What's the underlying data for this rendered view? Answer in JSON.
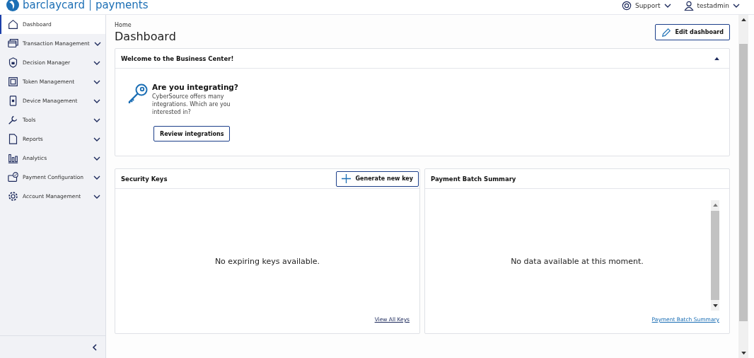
{
  "header": {
    "brand": "barclaycard",
    "product": "payments",
    "support": "Support",
    "user": "testadmin"
  },
  "sidebar": {
    "items": [
      {
        "label": "Dashboard",
        "selected": true
      },
      {
        "label": "Transaction Management",
        "selected": false,
        "expanded": false
      },
      {
        "label": "Decision Manager",
        "selected": false,
        "expanded": false
      },
      {
        "label": "Token Management",
        "selected": false,
        "expanded": false
      },
      {
        "label": "Device Management",
        "selected": false,
        "expanded": false
      },
      {
        "label": "Tools",
        "selected": false,
        "expanded": false
      },
      {
        "label": "Reports",
        "selected": false,
        "expanded": false
      },
      {
        "label": "Analytics",
        "selected": false,
        "expanded": false
      },
      {
        "label": "Payment Configuration",
        "selected": false,
        "expanded": false
      },
      {
        "label": "Account Management",
        "selected": false,
        "expanded": false
      }
    ]
  },
  "breadcrumb": "Home",
  "page_title": "Dashboard",
  "edit_button": "Edit dashboard",
  "welcome": {
    "title": "Welcome to the Business Center!",
    "expanded": true,
    "heading": "Are you integrating?",
    "text": "CyberSource offers many integrations. Which are you interested in?",
    "button": "Review integrations"
  },
  "security_keys": {
    "title": "Security Keys",
    "button": "Generate new key",
    "empty": "No expiring keys available.",
    "link": "View All Keys"
  },
  "batch_summary": {
    "title": "Payment Batch Summary",
    "empty": "No data available at this moment.",
    "link": "Payment Batch Summary"
  }
}
